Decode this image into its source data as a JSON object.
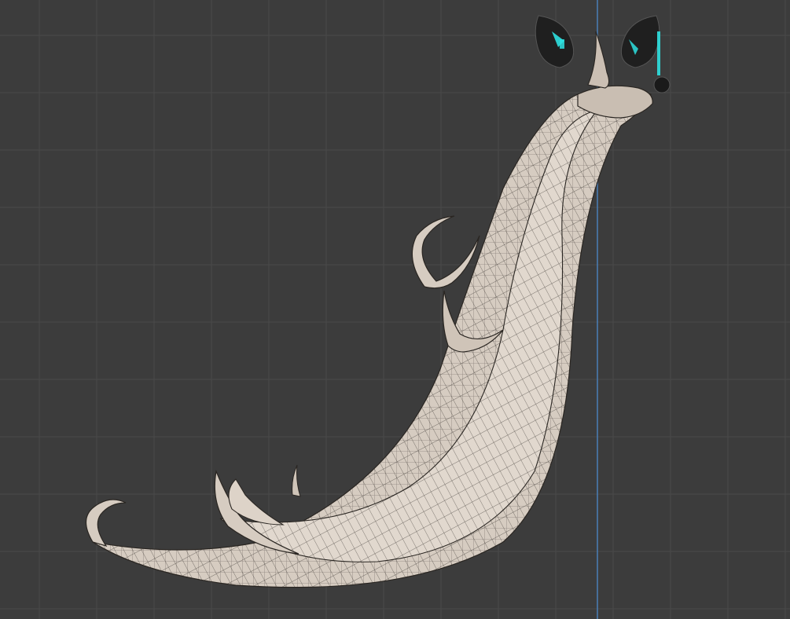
{
  "viewport": {
    "name": "3D viewport",
    "background_color": "#3c3c3c",
    "grid_color": "#4a4a4a",
    "axis_line_color": "#4a7fb8",
    "mesh_fill_color": "#d6ccc1",
    "mesh_wire_color": "#2a2622",
    "highlight_color": "#2ee0e0",
    "accessory_color": "#1a1a1a"
  }
}
